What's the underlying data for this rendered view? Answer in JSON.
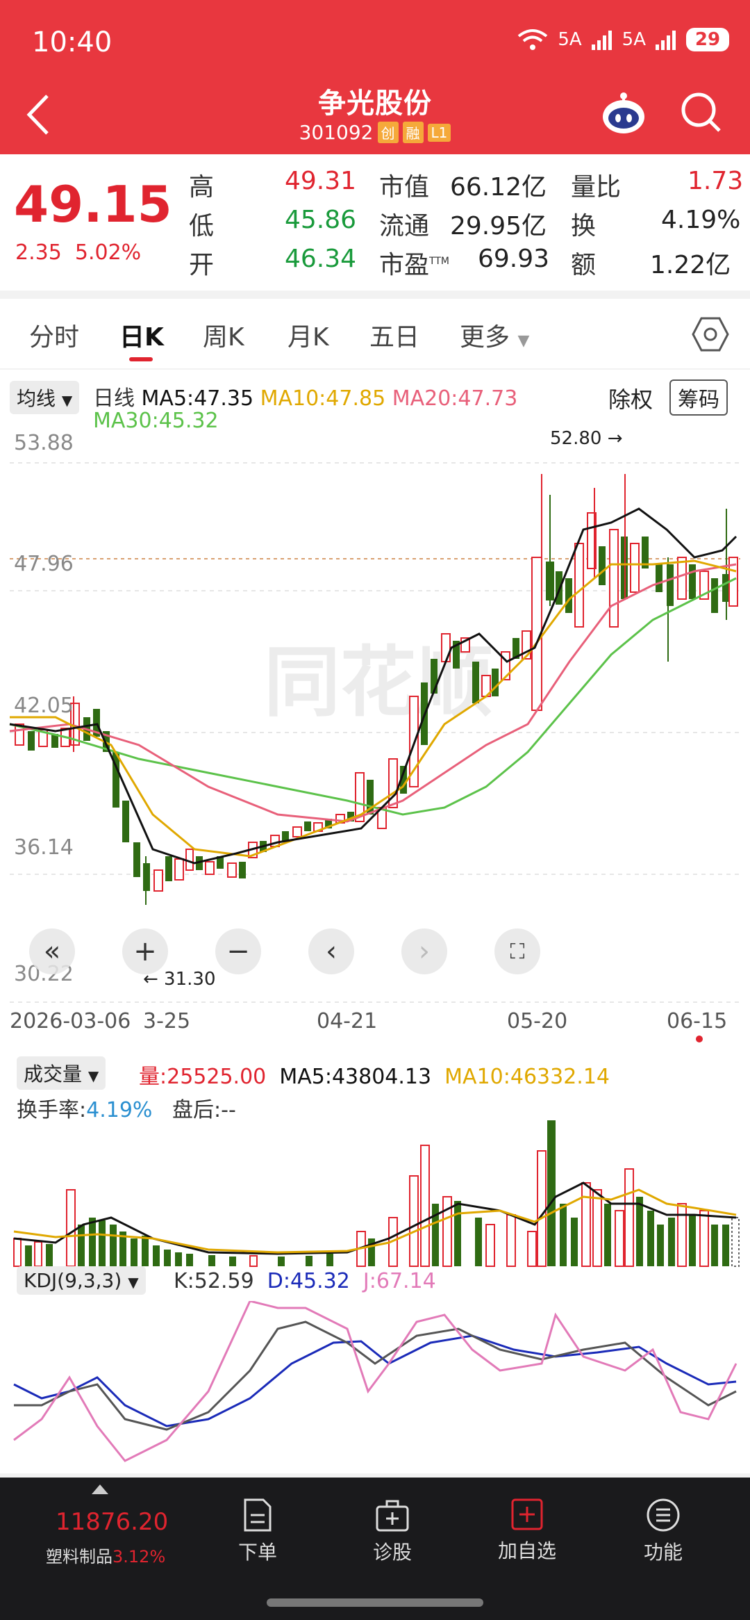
{
  "status": {
    "time": "10:40",
    "net1": "5A",
    "net2": "5A",
    "battery": "29"
  },
  "header": {
    "name": "争光股份",
    "code": "301092",
    "tags": [
      "创",
      "融",
      "L1"
    ]
  },
  "quote": {
    "price": "49.15",
    "change": "2.35",
    "pct": "5.02%",
    "high_label": "高",
    "high": "49.31",
    "low_label": "低",
    "low": "45.86",
    "open_label": "开",
    "open": "46.34",
    "mcap_label": "市值",
    "mcap": "66.12亿",
    "float_label": "流通",
    "float": "29.95亿",
    "pe_label": "市盈",
    "pe_sup": "TTM",
    "pe": "69.93",
    "vr_label": "量比",
    "vr": "1.73",
    "turn_label": "换",
    "turn": "4.19%",
    "amt_label": "额",
    "amt": "1.22亿"
  },
  "tabs": [
    "分时",
    "日K",
    "周K",
    "月K",
    "五日",
    "更多"
  ],
  "kline": {
    "ma_selector": "均线",
    "period": "日线",
    "ma5": "MA5:47.35",
    "ma10": "MA10:47.85",
    "ma20": "MA20:47.73",
    "ma30": "MA30:45.32",
    "fq": "除权",
    "chips": "筹码",
    "y_labels": [
      "53.88",
      "47.96",
      "42.05",
      "36.14",
      "30.22"
    ],
    "max_mark": "52.80 →",
    "min_mark": "← 31.30",
    "dates": [
      "2026-03-06",
      "3-25",
      "04-21",
      "05-20",
      "06-15"
    ],
    "watermark": "同花顺"
  },
  "volume": {
    "selector": "成交量",
    "vol": "量:25525.00",
    "ma5": "MA5:43804.13",
    "ma10": "MA10:46332.14",
    "turnover_label": "换手率:",
    "turnover": "4.19%",
    "after": "盘后:--"
  },
  "kdj": {
    "selector": "KDJ(9,3,3)",
    "k": "K:52.59",
    "d": "D:45.32",
    "j": "J:67.14"
  },
  "colors": {
    "up": "#e0242f",
    "down": "#2f6b13",
    "ma5": "#111111",
    "ma10": "#e0a800",
    "ma20": "#e8607a",
    "ma30": "#5cc24a"
  },
  "bottom": {
    "index_value": "11876.20",
    "index_name": "塑料制品",
    "index_pct": "3.12%",
    "items": [
      "下单",
      "诊股",
      "加自选",
      "功能"
    ]
  }
}
